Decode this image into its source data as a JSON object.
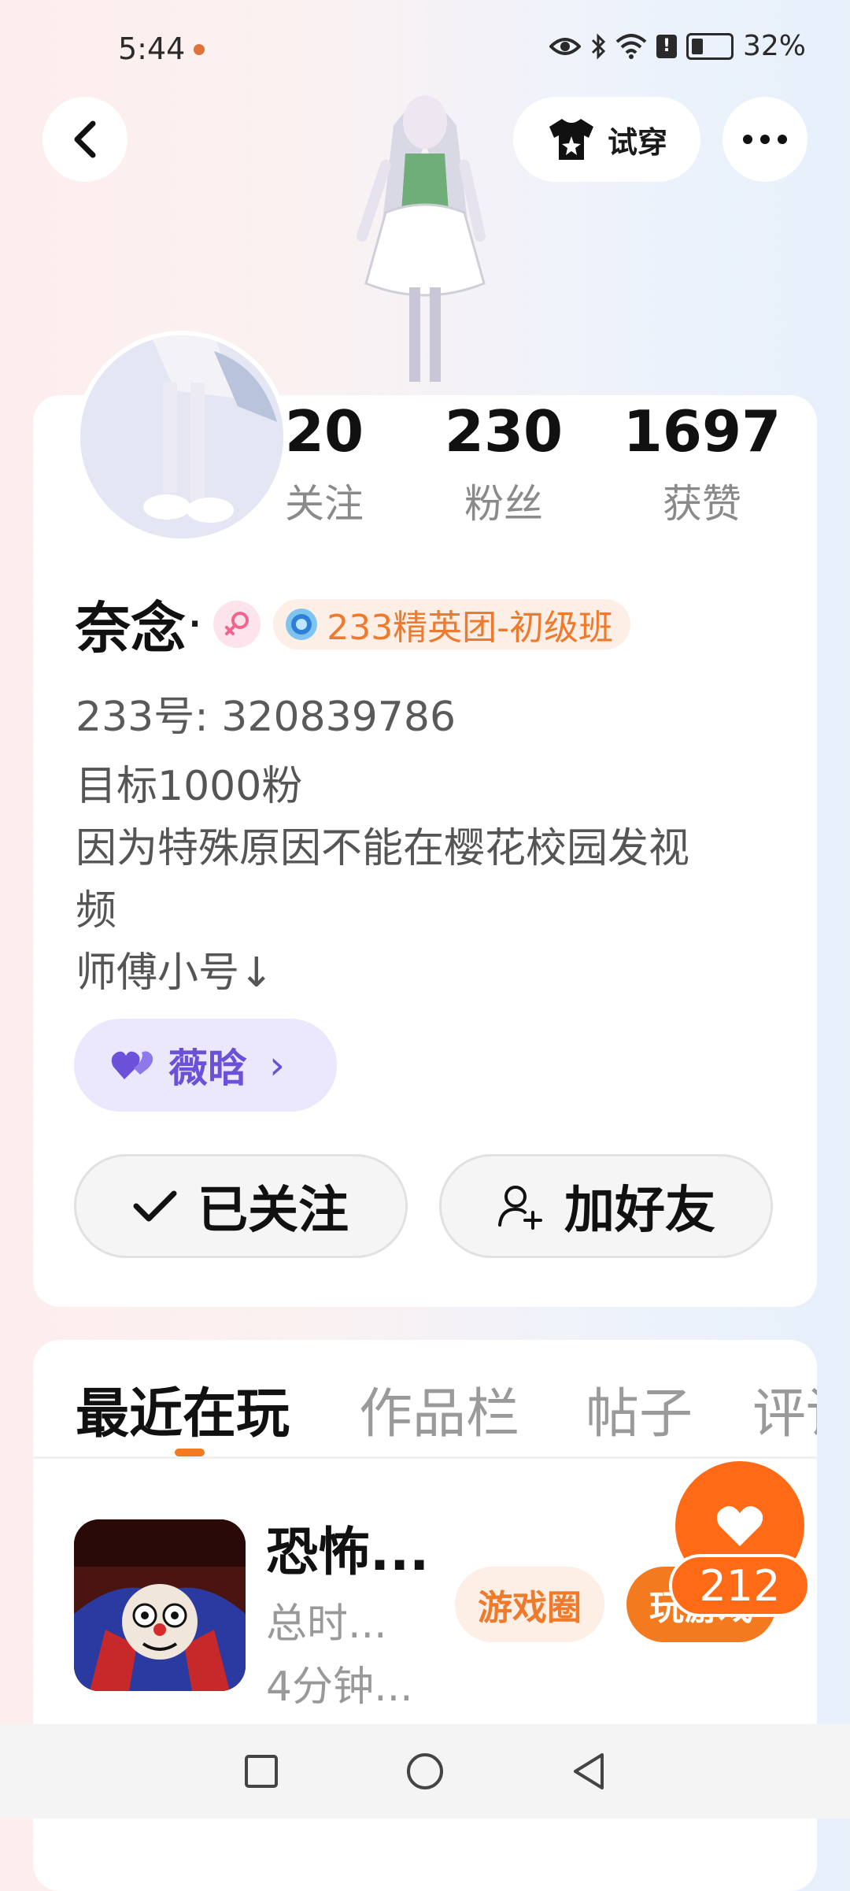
{
  "status_bar": {
    "time": "5:44",
    "battery": "32%",
    "icons": [
      "eye-icon",
      "bluetooth-icon",
      "wifi-icon",
      "alert-icon",
      "battery-icon"
    ]
  },
  "header": {
    "tryon_label": "试穿"
  },
  "profile": {
    "stats": [
      {
        "value": "20",
        "label": "关注"
      },
      {
        "value": "230",
        "label": "粉丝"
      },
      {
        "value": "1697",
        "label": "获赞"
      }
    ],
    "name": "奈念",
    "name_dot": "·",
    "rank_badge": "233精英团-初级班",
    "uid": "233号:  320839786",
    "bio_lines": [
      "目标1000粉",
      "因为特殊原因不能在樱花校园发视",
      "频",
      "师傅小号↓"
    ],
    "vibe_label": "薇晗",
    "vibe_chevron": "›",
    "followed_label": "已关注",
    "add_friend_label": "加好友"
  },
  "tabs": [
    {
      "label": "最近在玩",
      "active": true
    },
    {
      "label": "作品栏",
      "active": false
    },
    {
      "label": "帖子",
      "active": false
    },
    {
      "label": "评论",
      "active": false
    }
  ],
  "game": {
    "title": "恐怖...",
    "total_time": "总时...",
    "duration": "4分钟...",
    "circle_button": "游戏圈",
    "play_button": "玩游戏"
  },
  "like": {
    "count": "212"
  },
  "colors": {
    "accent": "#f47a1f",
    "rank_text": "#ef7a2c",
    "vibe": "#6b50d9"
  }
}
